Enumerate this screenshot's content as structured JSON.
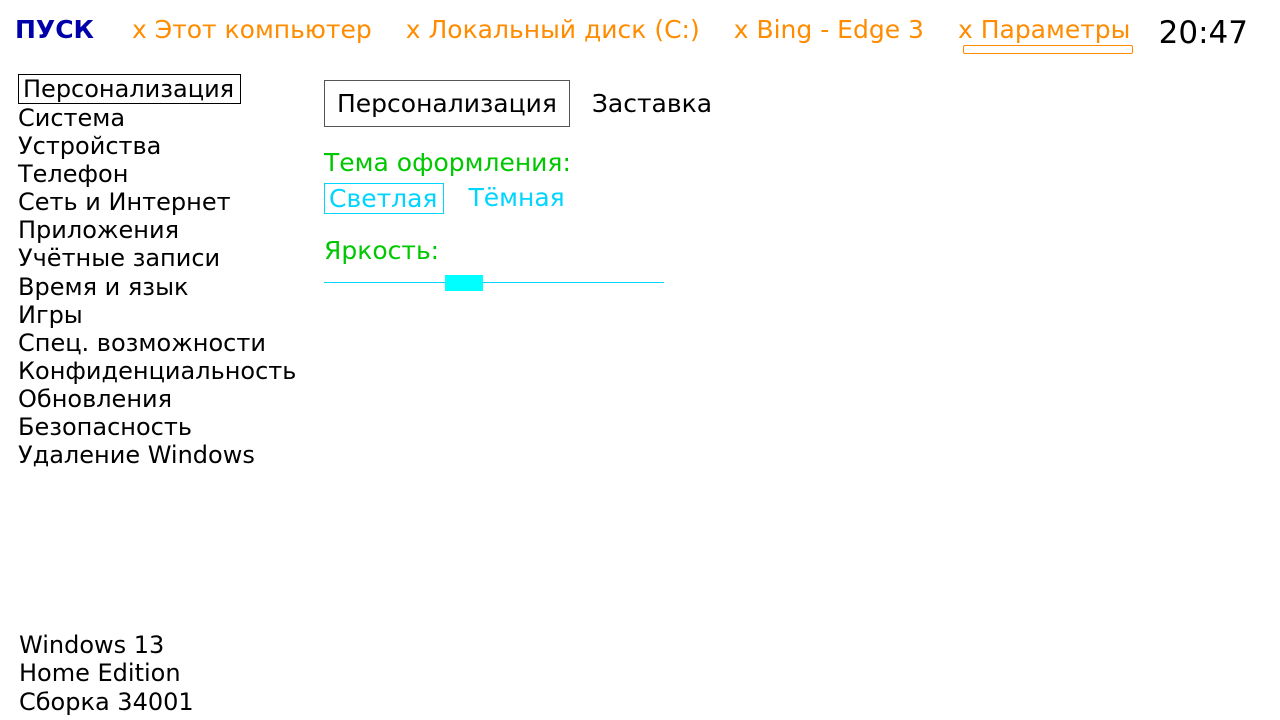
{
  "taskbar": {
    "start": "ПУСК",
    "items": [
      {
        "label": "x Этот компьютер",
        "active": false
      },
      {
        "label": "x Локальный диск (C:)",
        "active": false
      },
      {
        "label": "x Bing - Edge 3",
        "active": false
      },
      {
        "label": "x Параметры",
        "active": true
      }
    ],
    "clock": "20:47"
  },
  "nav": {
    "items": [
      {
        "label": "Персонализация",
        "selected": true
      },
      {
        "label": "Система",
        "selected": false
      },
      {
        "label": "Устройства",
        "selected": false
      },
      {
        "label": "Телефон",
        "selected": false
      },
      {
        "label": "Сеть и Интернет",
        "selected": false
      },
      {
        "label": "Приложения",
        "selected": false
      },
      {
        "label": "Учётные записи",
        "selected": false
      },
      {
        "label": "Время и язык",
        "selected": false
      },
      {
        "label": "Игры",
        "selected": false
      },
      {
        "label": "Спец. возможности",
        "selected": false
      },
      {
        "label": "Конфиденциальность",
        "selected": false
      },
      {
        "label": "Обновления",
        "selected": false
      },
      {
        "label": "Безопасность",
        "selected": false
      },
      {
        "label": "Удаление Windows",
        "selected": false
      }
    ]
  },
  "tabs": [
    {
      "label": "Персонализация",
      "selected": true
    },
    {
      "label": "Заставка",
      "selected": false
    }
  ],
  "settings": {
    "theme_label": "Тема оформления:",
    "theme_options": [
      {
        "label": "Светлая",
        "selected": true
      },
      {
        "label": "Тёмная",
        "selected": false
      }
    ],
    "brightness_label": "Яркость:",
    "brightness_percent": 40
  },
  "version": {
    "line1": "Windows 13",
    "line2": "Home Edition",
    "line3": "Сборка 34001"
  }
}
